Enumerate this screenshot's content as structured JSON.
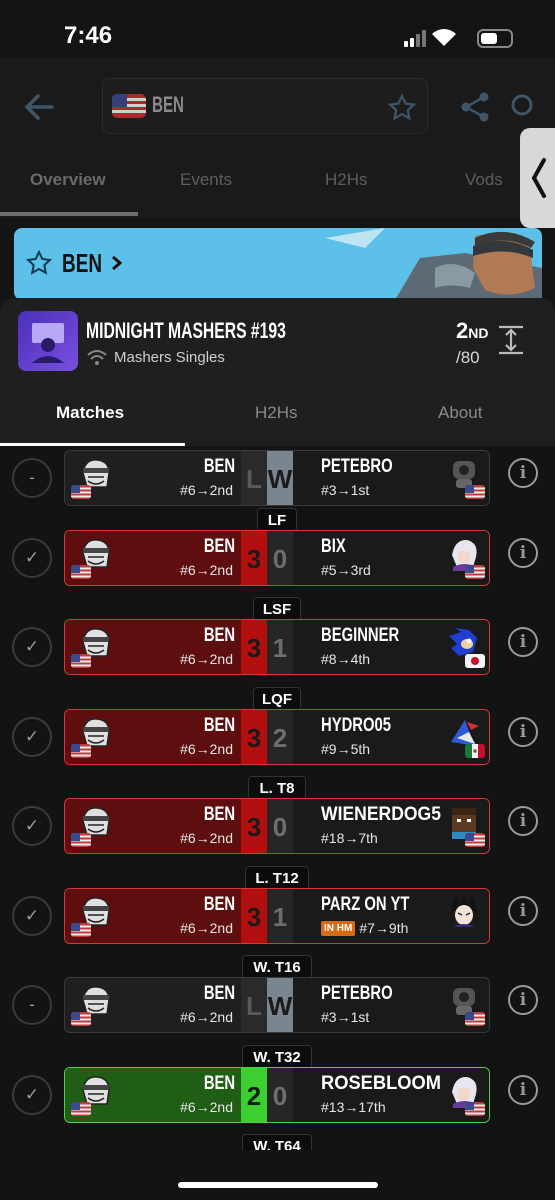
{
  "status_bar": {
    "time": "7:46"
  },
  "header": {
    "search_name": "BEN",
    "tabs": [
      "Overview",
      "Events",
      "H2Hs",
      "Vods"
    ]
  },
  "banner": {
    "name": "BEN"
  },
  "event": {
    "title": "MIDNIGHT MASHERS #193",
    "subtitle": "Mashers Singles",
    "placement": "2",
    "placement_suffix": "ND",
    "total": "/80"
  },
  "subtabs": [
    "Matches",
    "H2Hs",
    "About"
  ],
  "matches": [
    {
      "status": "-",
      "result": "gray",
      "left_name": "BEN",
      "left_seed": "#6→2nd",
      "score_left": "L",
      "score_right": "W",
      "right_name": "PETEBRO",
      "right_seed": "#3→1st",
      "right_flag": "us",
      "right_icon": "robot-icon",
      "round": ""
    },
    {
      "status": "check",
      "result": "loss",
      "left_name": "BEN",
      "left_seed": "#6→2nd",
      "score_left": "3",
      "score_right": "0",
      "right_name": "BIX",
      "right_seed": "#5→3rd",
      "right_flag": "us",
      "right_icon": "white-hair-character-icon",
      "round": "LF"
    },
    {
      "status": "check",
      "result": "loss",
      "left_name": "BEN",
      "left_seed": "#6→2nd",
      "score_left": "3",
      "score_right": "1",
      "right_name": "BEGINNER",
      "right_seed": "#8→4th",
      "right_flag": "jp",
      "right_icon": "blue-hedgehog-icon",
      "round": "LSF"
    },
    {
      "status": "check",
      "result": "loss",
      "left_name": "BEN",
      "left_seed": "#6→2nd",
      "score_left": "3",
      "score_right": "2",
      "right_name": "HYDRO05",
      "right_seed": "#9→5th",
      "right_flag": "mx",
      "right_icon": "bird-pilot-icon",
      "round": "LQF"
    },
    {
      "status": "check",
      "result": "loss",
      "left_name": "BEN",
      "left_seed": "#6→2nd",
      "score_left": "3",
      "score_right": "0",
      "right_name": "WIENERDOG5",
      "right_seed": "#18→7th",
      "right_flag": "us",
      "right_icon": "blocky-character-icon",
      "round": "L. T8"
    },
    {
      "status": "check",
      "result": "loss",
      "left_name": "BEN",
      "left_seed": "#6→2nd",
      "score_left": "3",
      "score_right": "1",
      "right_name": "PARZ ON YT",
      "right_seed": "#7→9th",
      "right_badge": "IN HM",
      "right_flag": "",
      "right_icon": "spiky-hair-character-icon",
      "round": "L. T12"
    },
    {
      "status": "-",
      "result": "gray",
      "left_name": "BEN",
      "left_seed": "#6→2nd",
      "score_left": "L",
      "score_right": "W",
      "right_name": "PETEBRO",
      "right_seed": "#3→1st",
      "right_flag": "us",
      "right_icon": "robot-icon",
      "round": "W. T16"
    },
    {
      "status": "check",
      "result": "win",
      "left_name": "BEN",
      "left_seed": "#6→2nd",
      "score_left": "2",
      "score_right": "0",
      "right_name": "ROSEBLOOM",
      "right_seed": "#13→17th",
      "right_flag": "us",
      "right_icon": "white-hair-character-icon",
      "round": "W. T32"
    },
    {
      "round": "W. T64"
    }
  ],
  "colors": {
    "loss": "#d83838",
    "win": "#4cd24a",
    "banner": "#5cc0e8"
  }
}
